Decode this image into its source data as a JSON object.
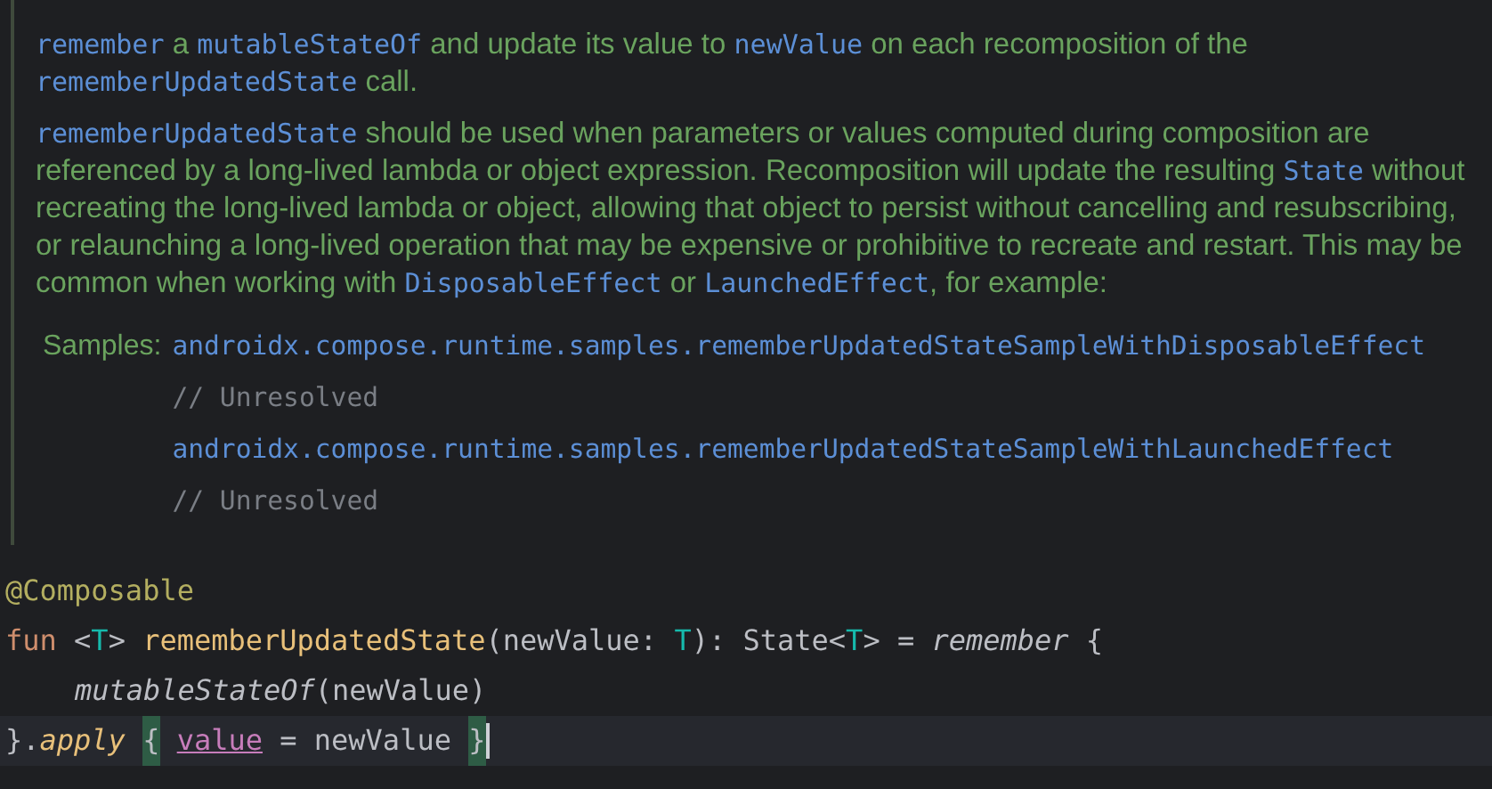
{
  "doc": {
    "paragraphs": [
      [
        {
          "kind": "code",
          "text": "remember"
        },
        {
          "kind": "text",
          "text": " a "
        },
        {
          "kind": "code",
          "text": "mutableStateOf"
        },
        {
          "kind": "text",
          "text": " and update its value to "
        },
        {
          "kind": "code",
          "text": "newValue"
        },
        {
          "kind": "text",
          "text": " on each recomposition of the "
        },
        {
          "kind": "code",
          "text": "rememberUpdatedState"
        },
        {
          "kind": "text",
          "text": " call."
        }
      ],
      [
        {
          "kind": "code",
          "text": "rememberUpdatedState"
        },
        {
          "kind": "text",
          "text": " should be used when parameters or values computed during composition are referenced by a long-lived lambda or object expression. Recomposition will update the resulting "
        },
        {
          "kind": "code",
          "text": "State"
        },
        {
          "kind": "text",
          "text": " without recreating the long-lived lambda or object, allowing that object to persist without cancelling and resubscribing, or relaunching a long-lived operation that may be expensive or prohibitive to recreate and restart. This may be common when working with "
        },
        {
          "kind": "code",
          "text": "DisposableEffect"
        },
        {
          "kind": "text",
          "text": " or "
        },
        {
          "kind": "code",
          "text": "LaunchedEffect"
        },
        {
          "kind": "text",
          "text": ", for example:"
        }
      ]
    ],
    "samples_label": "Samples:",
    "samples": [
      {
        "kind": "link",
        "text": "androidx.compose.runtime.samples.rememberUpdatedStateSampleWithDisposableEffect"
      },
      {
        "kind": "comment",
        "text": "// Unresolved"
      },
      {
        "kind": "link",
        "text": "androidx.compose.runtime.samples.rememberUpdatedStateSampleWithLaunchedEffect"
      },
      {
        "kind": "comment",
        "text": "// Unresolved"
      }
    ]
  },
  "code": {
    "lines": [
      {
        "current": false,
        "indented": false,
        "tokens": [
          {
            "kind": "annotation",
            "text": "@Composable"
          }
        ]
      },
      {
        "current": false,
        "indented": false,
        "tokens": [
          {
            "kind": "keyword",
            "text": "fun"
          },
          {
            "kind": "plain",
            "text": " <"
          },
          {
            "kind": "typeparam",
            "text": "T"
          },
          {
            "kind": "plain",
            "text": "> "
          },
          {
            "kind": "function",
            "text": "rememberUpdatedState"
          },
          {
            "kind": "plain",
            "text": "(newValue: "
          },
          {
            "kind": "typeparam",
            "text": "T"
          },
          {
            "kind": "plain",
            "text": "): State<"
          },
          {
            "kind": "typeparam",
            "text": "T"
          },
          {
            "kind": "plain",
            "text": "> = "
          },
          {
            "kind": "italic",
            "text": "remember"
          },
          {
            "kind": "plain",
            "text": " {"
          }
        ]
      },
      {
        "current": false,
        "indented": true,
        "tokens": [
          {
            "kind": "italic",
            "text": "mutableStateOf"
          },
          {
            "kind": "plain",
            "text": "(newValue)"
          }
        ]
      },
      {
        "current": true,
        "indented": false,
        "tokens": [
          {
            "kind": "plain",
            "text": "}."
          },
          {
            "kind": "italic-fn",
            "text": "apply"
          },
          {
            "kind": "brace",
            "text": "{",
            "space_before": true
          },
          {
            "kind": "property",
            "text": "value",
            "space_before": true
          },
          {
            "kind": "plain",
            "text": " = newValue "
          },
          {
            "kind": "brace",
            "text": "}"
          }
        ]
      }
    ]
  }
}
